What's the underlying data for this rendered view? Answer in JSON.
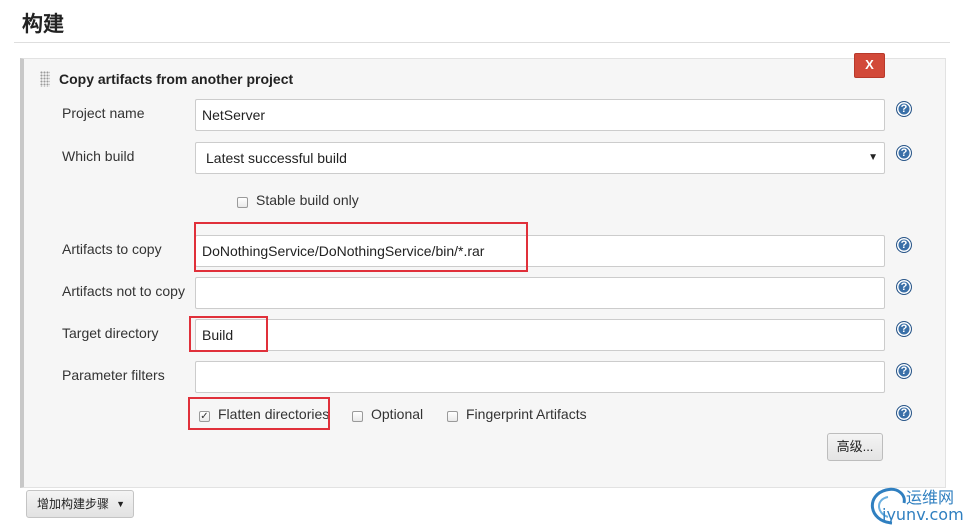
{
  "section": {
    "title": "构建"
  },
  "step": {
    "title": "Copy artifacts from another project",
    "delete_label": "X"
  },
  "fields": {
    "project_name": {
      "label": "Project name",
      "value": "NetServer"
    },
    "which_build": {
      "label": "Which build",
      "value": "Latest successful build"
    },
    "stable_only": {
      "label": "Stable build only",
      "checked": false
    },
    "artifacts": {
      "label": "Artifacts to copy",
      "value": "DoNothingService/DoNothingService/bin/*.rar"
    },
    "artifacts_not": {
      "label": "Artifacts not to copy",
      "value": ""
    },
    "target_dir": {
      "label": "Target directory",
      "value": "Build"
    },
    "param_filters": {
      "label": "Parameter filters",
      "value": ""
    }
  },
  "options": {
    "flatten": {
      "label": "Flatten directories",
      "checked": true
    },
    "optional": {
      "label": "Optional",
      "checked": false
    },
    "fingerprint": {
      "label": "Fingerprint Artifacts",
      "checked": false
    }
  },
  "help_glyph": "?",
  "advanced_label": "高级...",
  "add_step_label": "增加构建步骤",
  "watermark": {
    "cn": "运维网",
    "en": "iyunv.com"
  },
  "colors": {
    "delete": "#d24939",
    "help": "#3b70a8",
    "annotation": "#e0303a",
    "watermark": "#2f7fc0"
  }
}
